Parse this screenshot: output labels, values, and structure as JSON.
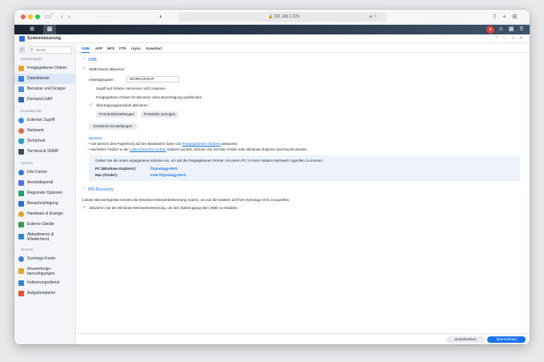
{
  "browser": {
    "url": "192.168.1.229"
  },
  "app": {
    "title": "Systemsteuerung"
  },
  "sidebar": {
    "search_placeholder": "Suche",
    "sections": {
      "file_sharing": "Dateifreigabe",
      "connectivity": "Konnektivität",
      "system": "System",
      "services": "Dienste"
    },
    "items": [
      {
        "label": "Freigegebener Ordner",
        "color": "#e9a23b"
      },
      {
        "label": "Dateidienste",
        "color": "#3a7fd9"
      },
      {
        "label": "Benutzer und Gruppe",
        "color": "#4a8fd6"
      },
      {
        "label": "Domain/LDAP",
        "color": "#3566b0"
      },
      {
        "label": "Externer Zugriff",
        "color": "#3a8ddf"
      },
      {
        "label": "Netzwerk",
        "color": "#e06a4a"
      },
      {
        "label": "Sicherheit",
        "color": "#2fa0c8"
      },
      {
        "label": "Terminal & SNMP",
        "color": "#3d4b5c"
      },
      {
        "label": "Info-Center",
        "color": "#2e7bd6"
      },
      {
        "label": "Anmeldeportal",
        "color": "#5b6fe0"
      },
      {
        "label": "Regionale Optionen",
        "color": "#2f9d6a"
      },
      {
        "label": "Benachrichtigung",
        "color": "#2d6fd0"
      },
      {
        "label": "Hardware & Energie",
        "color": "#e3a22c"
      },
      {
        "label": "Externe Geräte",
        "color": "#3c9a56"
      },
      {
        "label": "Aktualisieren & Wiederherst.",
        "color": "#2f86d8"
      },
      {
        "label": "Synology-Konto",
        "color": "#3d7fd8"
      },
      {
        "label": "Anwendungs-berechtigungen",
        "color": "#e2a52e"
      },
      {
        "label": "Indizierungsdienst",
        "color": "#3b86d4"
      },
      {
        "label": "Aufgabenplaner",
        "color": "#e0563f"
      }
    ]
  },
  "tabs": [
    "SMB",
    "AFP",
    "NFS",
    "FTP",
    "rsync",
    "Erweitert"
  ],
  "smb": {
    "header": "SMB",
    "enable_label": "SMB-Dienst aktivieren",
    "workgroup_label": "Arbeitsgruppen:",
    "workgroup_value": "WORKGROUP",
    "option1": "Zugriff auf frühere Versionen nicht zulassen",
    "option2": "Freigegebene Ordner für Benutzer ohne Berechtigung ausblenden",
    "option3": "Übertragungsprotokoll aktivieren",
    "log_settings_btn": "Protokolleinstellungen",
    "show_logs_btn": "Protokolle anzeigen",
    "advanced_btn": "Erweiterte Einstellungen",
    "hint_title": "Hinweis:",
    "hint1_pre": "• Sie können den Papierkorb auf der Bearbeiten Seite von",
    "hint1_link": "Freigegebenen Ordnern",
    "hint1_post": "aktivieren.",
    "hint2_pre": "• Nachdem Ordner in der",
    "hint2_link": "Liste indizierter Ordner",
    "hint2_post": "indiziert wurden, können Sie mit Mac Finder oder Windows Explorer durchsucht werden.",
    "info_text": "Geben Sie die unten angegebene Adresse ein, um auf die freigegebenen Ordner mit einem PC in Ihrem lokalen Netzwerk zugreifen zu können:",
    "pc_label": "PC (Windows Explorer):",
    "pc_value": "\\\\Synology-NAS",
    "mac_label": "Mac (Finder):",
    "mac_value": "smb://Synology-NAS"
  },
  "wsd": {
    "header": "WS-Discovery",
    "desc": "Lokale Netzwerkgeräte können die Windows-Netzwerkerkennung nutzen, um auf die Dateien auf Ihrer Synology NAS zuzugreifen.",
    "enable_label": "Aktivieren Sie die Windows-Netzwerkerkennung, um den Dateizugang über SMB zu erlauben"
  },
  "footer": {
    "reset_label": "Zurücksetzen",
    "apply_label": "Übernehmen"
  },
  "colors": {
    "accent": "#1a73e8"
  }
}
